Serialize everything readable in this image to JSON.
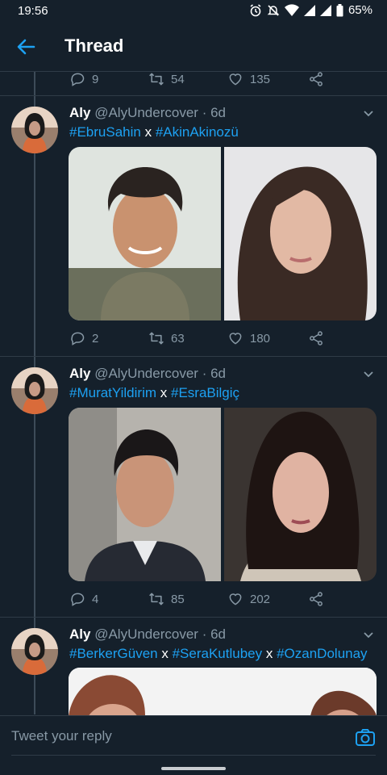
{
  "status_bar": {
    "time": "19:56",
    "battery": "65%"
  },
  "header": {
    "title": "Thread"
  },
  "top_actions": {
    "replies": "9",
    "retweets": "54",
    "likes": "135"
  },
  "tweets": [
    {
      "display_name": "Aly",
      "handle": "@AlyUndercover",
      "age": "· 6d",
      "tags": [
        "#EbruSahin",
        "#AkinAkinozü"
      ],
      "separator": "x",
      "stats": {
        "replies": "2",
        "retweets": "63",
        "likes": "180"
      }
    },
    {
      "display_name": "Aly",
      "handle": "@AlyUndercover",
      "age": "· 6d",
      "tags": [
        "#MuratYildirim",
        "#EsraBilgiç"
      ],
      "separator": "x",
      "stats": {
        "replies": "4",
        "retweets": "85",
        "likes": "202"
      }
    },
    {
      "display_name": "Aly",
      "handle": "@AlyUndercover",
      "age": "· 6d",
      "tags": [
        "#BerkerGüven",
        "#SeraKutlubey",
        "#OzanDolunay"
      ],
      "separator": "x"
    }
  ],
  "reply_bar": {
    "placeholder": "Tweet your reply"
  },
  "colors": {
    "background": "#15202b",
    "accent": "#1da1f2",
    "muted": "#8899a6",
    "divider": "#2f3b47"
  }
}
